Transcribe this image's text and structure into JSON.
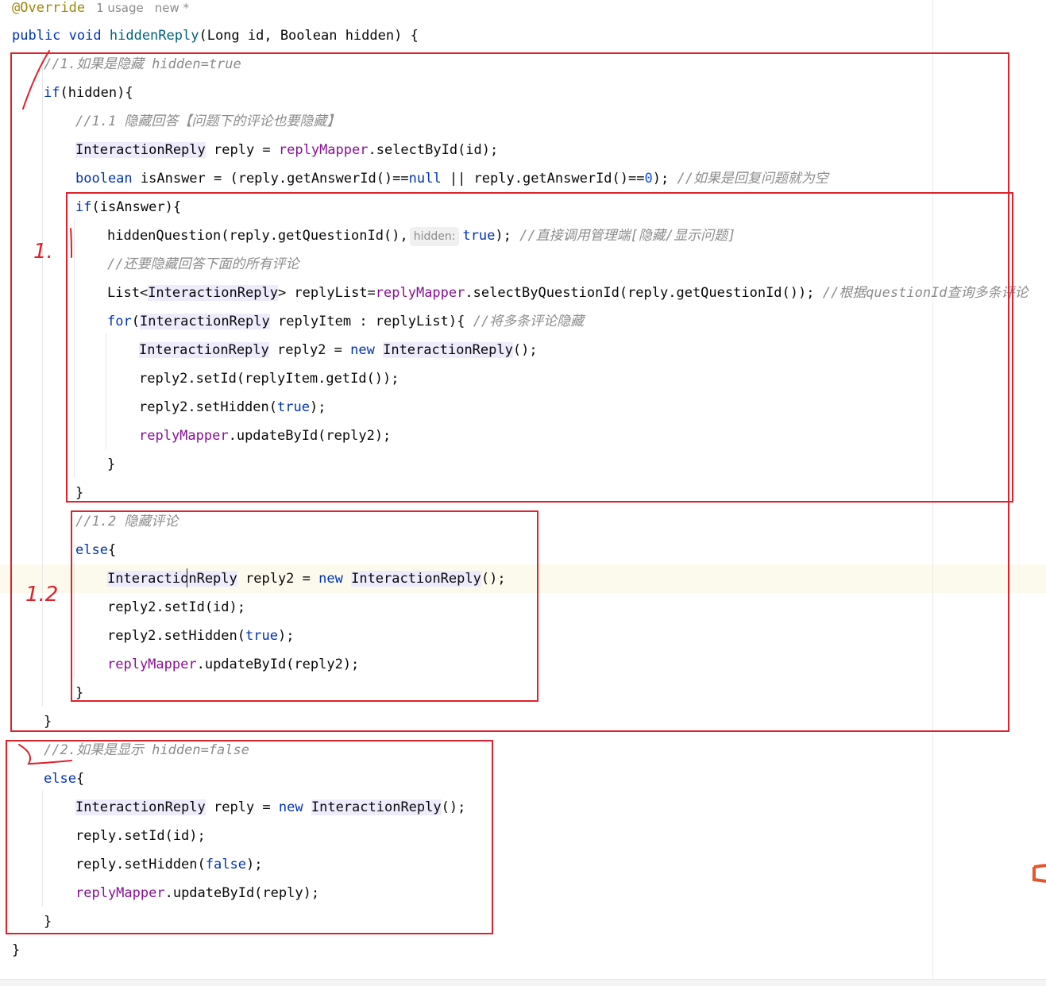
{
  "header": {
    "annotation": "@Override",
    "usages": "1 usage",
    "author": "new *"
  },
  "code": {
    "l1": [
      "public",
      "void",
      "hiddenReply",
      "(Long id, Boolean hidden) {"
    ],
    "l2_comment": "//1.如果是隐藏 hidden=true",
    "l3": [
      "if",
      "(hidden){"
    ],
    "l4_comment": "//1.1 隐藏回答【问题下的评论也要隐藏】",
    "l5": [
      "InteractionReply",
      " reply = ",
      "replyMapper",
      ".selectById(id);"
    ],
    "l6": [
      "boolean",
      " isAnswer = (reply.getAnswerId()==",
      "null",
      " || reply.getAnswerId()==",
      "0",
      "); ",
      "//如果是回复问题就为空"
    ],
    "l7": [
      "if",
      "(isAnswer){"
    ],
    "l8": [
      "hiddenQuestion(reply.getQuestionId(),",
      "hidden:",
      "true",
      "); ",
      "//直接调用管理端[隐藏/显示问题]"
    ],
    "l9_comment": "//还要隐藏回答下面的所有评论",
    "l10": [
      "List<",
      "InteractionReply",
      "> replyList=",
      "replyMapper",
      ".selectByQuestionId(reply.getQuestionId()); ",
      "//根据questionId查询多条评论"
    ],
    "l11": [
      "for",
      "(",
      "InteractionReply",
      " replyItem : replyList){ ",
      "//将多条评论隐藏"
    ],
    "l12": [
      "InteractionReply",
      " reply2 = ",
      "new",
      " ",
      "InteractionReply",
      "();"
    ],
    "l13": "reply2.setId(replyItem.getId());",
    "l14": [
      "reply2.setHidden(",
      "true",
      ");"
    ],
    "l15": [
      "replyMapper",
      ".updateById(reply2);"
    ],
    "l16": "}",
    "l17": "}",
    "l18_comment": "//1.2 隐藏评论",
    "l19": [
      "else",
      "{"
    ],
    "l20": [
      "InteractionReply",
      " reply2 = ",
      "new",
      " ",
      "InteractionReply",
      "();"
    ],
    "l21": "reply2.setId(id);",
    "l22": [
      "reply2.setHidden(",
      "true",
      ");"
    ],
    "l23": [
      "replyMapper",
      ".updateById(reply2);"
    ],
    "l24": "}",
    "l25": "}",
    "l26_comment": "//2.如果是显示 hidden=false",
    "l27": [
      "else",
      "{"
    ],
    "l28": [
      "InteractionReply",
      " reply = ",
      "new",
      " ",
      "InteractionReply",
      "();"
    ],
    "l29": "reply.setId(id);",
    "l30": [
      "reply.setHidden(",
      "false",
      ");"
    ],
    "l31": [
      "replyMapper",
      ".updateById(reply);"
    ],
    "l32": "}",
    "l33": "}"
  },
  "handwritten": {
    "mark_1_1": "1.",
    "mark_1_2": "1.2"
  },
  "colors": {
    "keyword": "#0033b3",
    "method": "#00627a",
    "field": "#871094",
    "comment": "#8c8c8c",
    "annotation": "#9e880d",
    "type_highlight": "#edebfc",
    "markup_red": "#e0202a"
  }
}
